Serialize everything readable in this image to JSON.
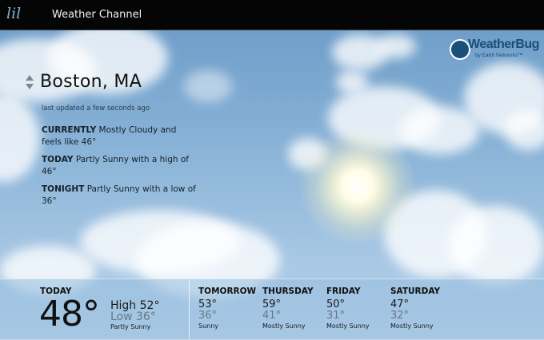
{
  "window": {
    "app_logo": "lil",
    "title": "Weather Channel"
  },
  "brand": {
    "name": "WeatherBug",
    "sub": "by Earth Networks™"
  },
  "location": {
    "city": "Boston,  MA",
    "updated": "last updated a few seconds ago"
  },
  "summary": {
    "currently_label": "CURRENTLY",
    "currently_text": " Mostly Cloudy and feels like 46°",
    "today_label": "TODAY",
    "today_text": " Partly Sunny with a high of 46°",
    "tonight_label": "TONIGHT",
    "tonight_text": " Partly Sunny with a low of 36°"
  },
  "today": {
    "label": "TODAY",
    "temp": "48°",
    "high": "High 52°",
    "low": "Low 36°",
    "condition": "Partly Sunny"
  },
  "forecast": [
    {
      "day": "TOMORROW",
      "high": "53°",
      "low": "36°",
      "condition": "Sunny"
    },
    {
      "day": "THURSDAY",
      "high": "59°",
      "low": "41°",
      "condition": "Mostly Sunny"
    },
    {
      "day": "FRIDAY",
      "high": "50°",
      "low": "31°",
      "condition": "Mostly Sunny"
    },
    {
      "day": "SATURDAY",
      "high": "47°",
      "low": "32°",
      "condition": "Mostly Sunny"
    }
  ],
  "icons": {
    "location_switcher": "up-down-arrows-icon",
    "brand_logo": "weatherbug-logo-icon"
  },
  "colors": {
    "topbar": "#050505",
    "sky": "#8bb4d8",
    "low_temp": "#62798d"
  }
}
